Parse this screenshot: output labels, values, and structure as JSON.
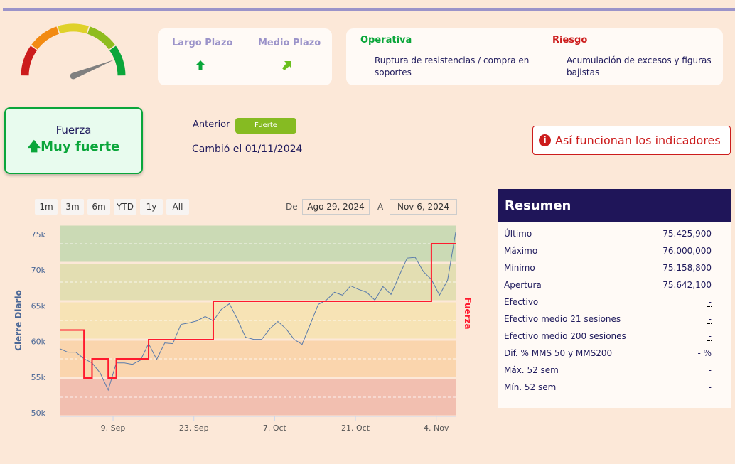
{
  "colors": {
    "accent": "#1f1559",
    "green": "#0aa63a",
    "red": "#cc1c1c",
    "purple": "#9b93c9"
  },
  "gauge": {
    "segments": [
      "#cc1c1c",
      "#f28a12",
      "#dfd12a",
      "#8fbc1e",
      "#0aa63a"
    ],
    "level": 0.88
  },
  "plazo": {
    "largo": {
      "label": "Largo Plazo",
      "icon": "arrow-up-icon"
    },
    "medio": {
      "label": "Medio Plazo",
      "icon": "arrow-up-right-icon"
    }
  },
  "operativa": {
    "title": "Operativa",
    "text": "Ruptura de resistencias / compra en soportes"
  },
  "riesgo": {
    "title": "Riesgo",
    "text": "Acumulación de excesos y figuras bajistas"
  },
  "fuerza": {
    "title": "Fuerza",
    "value": "Muy fuerte"
  },
  "anterior": {
    "label": "Anterior",
    "value": "Fuerte"
  },
  "cambio": "Cambió el 01/11/2024",
  "info_button": "Así funcionan los indicadores",
  "range": {
    "buttons": [
      "1m",
      "3m",
      "6m",
      "YTD",
      "1y",
      "All"
    ],
    "from_label": "De",
    "from": "Ago 29, 2024",
    "to_label": "A",
    "to": "Nov 6, 2024"
  },
  "resumen": {
    "title": "Resumen",
    "rows": [
      {
        "label": "Último",
        "value": "75.425,900"
      },
      {
        "label": "Máximo",
        "value": "76.000,000"
      },
      {
        "label": "Mínimo",
        "value": "75.158,800"
      },
      {
        "label": "Apertura",
        "value": "75.642,100"
      },
      {
        "label": "Efectivo",
        "value": "-"
      },
      {
        "label": "Efectivo medio 21 sesiones",
        "value": "-"
      },
      {
        "label": "Efectivo medio 200 sesiones",
        "value": "-"
      },
      {
        "label": "Dif. % MMS 50 y MMS200",
        "value": "- %"
      },
      {
        "label": "Máx. 52 sem",
        "value": "-"
      },
      {
        "label": "Mín. 52 sem",
        "value": "-"
      }
    ]
  },
  "chart_data": {
    "type": "line",
    "ylabel": "Cierre Diario",
    "y2label": "Fuerza",
    "ylim": [
      49.5,
      76.4
    ],
    "y2lim": [
      0,
      10
    ],
    "yticks": [
      {
        "v": 50,
        "label": "50k"
      },
      {
        "v": 55,
        "label": "55k"
      },
      {
        "v": 60,
        "label": "60k"
      },
      {
        "v": 65,
        "label": "65k"
      },
      {
        "v": 70,
        "label": "70k"
      },
      {
        "v": 75,
        "label": "75k"
      }
    ],
    "xticks": [
      {
        "i": 6.6,
        "label": "9. Sep"
      },
      {
        "i": 16.6,
        "label": "23. Sep"
      },
      {
        "i": 26.6,
        "label": "7. Oct"
      },
      {
        "i": 36.6,
        "label": "21. Oct"
      },
      {
        "i": 46.6,
        "label": "4. Nov"
      }
    ],
    "bands": [
      "#cbdab5",
      "#e3deb2",
      "#f7e3b5",
      "#fad5ad",
      "#f2bfb0"
    ],
    "series": [
      {
        "name": "Cierre Diario",
        "color": "#5a7bab",
        "values": [
          59.0,
          58.5,
          58.5,
          57.6,
          57.0,
          55.6,
          53.2,
          57.0,
          57.0,
          56.8,
          57.4,
          59.7,
          57.5,
          59.8,
          59.7,
          62.4,
          62.6,
          62.9,
          63.5,
          62.9,
          64.5,
          65.3,
          63.1,
          60.6,
          60.3,
          60.3,
          61.8,
          62.8,
          61.8,
          60.3,
          59.6,
          62.4,
          65.2,
          65.8,
          66.9,
          66.5,
          67.8,
          67.3,
          66.9,
          65.8,
          67.7,
          66.6,
          69.2,
          71.7,
          71.8,
          69.8,
          68.7,
          66.5,
          68.6,
          75.3
        ]
      },
      {
        "name": "Fuerza",
        "color": "#ff1a2e",
        "step": true,
        "values": [
          4.5,
          4.5,
          4.5,
          2,
          3,
          3,
          2,
          3,
          3,
          3,
          3,
          4,
          4,
          4,
          4,
          4,
          4,
          4,
          4,
          6,
          6,
          6,
          6,
          6,
          6,
          6,
          6,
          6,
          6,
          6,
          6,
          6,
          6,
          6,
          6,
          6,
          6,
          6,
          6,
          6,
          6,
          6,
          6,
          6,
          6,
          6,
          9,
          9,
          9,
          9
        ]
      }
    ]
  }
}
